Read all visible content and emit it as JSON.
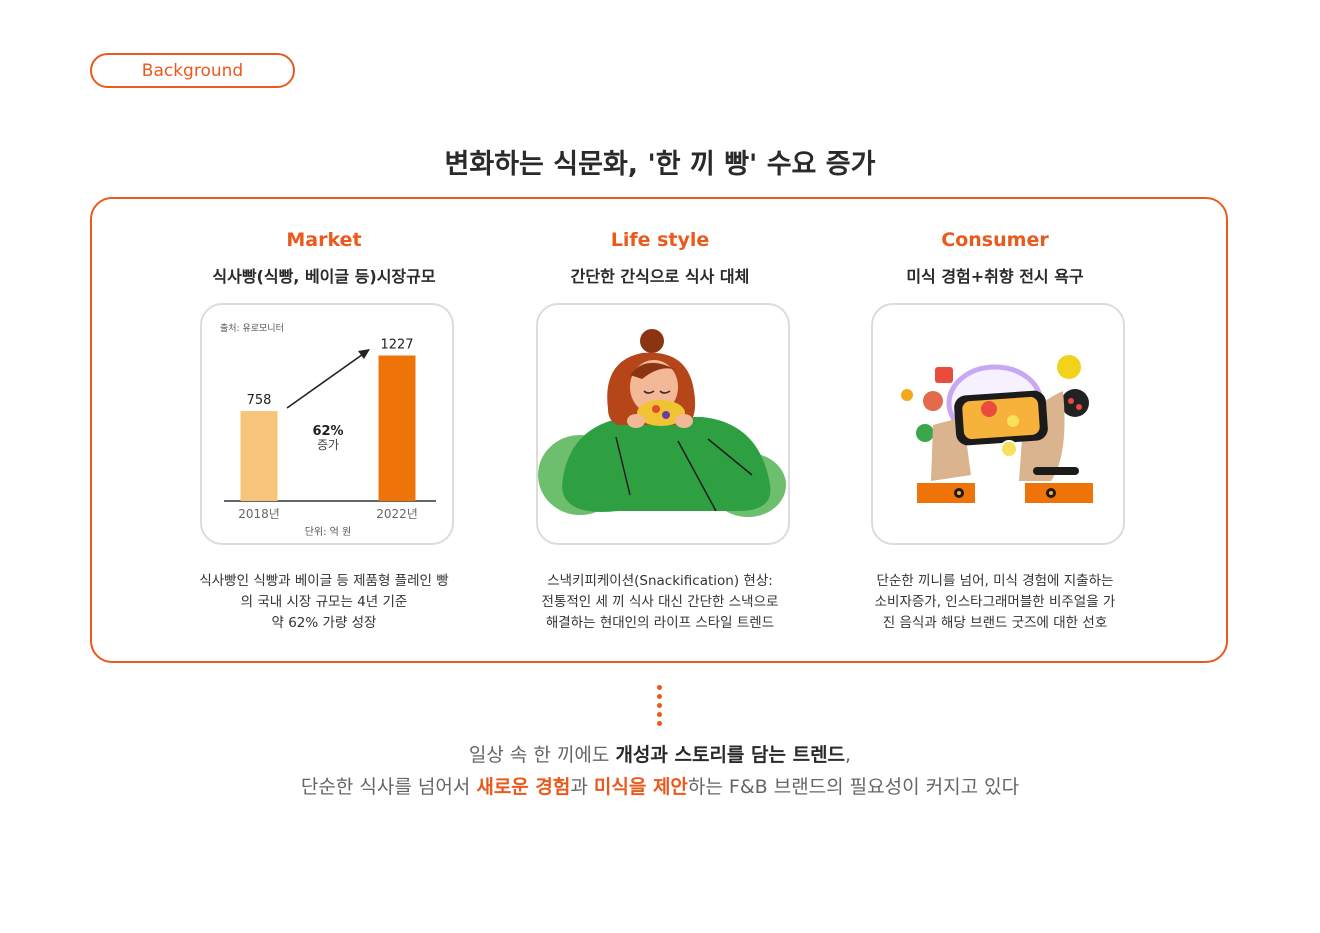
{
  "section_label": "Background",
  "main_title": "변화하는 식문화, '한 끼 빵' 수요 증가",
  "columns": [
    {
      "heading": "Market",
      "subtitle": "식사빵(식빵, 베이글 등)시장규모",
      "desc": [
        "식사빵인 식빵과 베이글 등 제품형 플레인 빵",
        "의 국내 시장 규모는 4년 기준",
        "약 62% 가량 성장"
      ]
    },
    {
      "heading": "Life style",
      "subtitle": "간단한 간식으로 식사 대체",
      "desc": [
        "스낵키피케이션(Snackification) 현상:",
        "전통적인 세 끼 식사 대신 간단한 스낵으로",
        "해결하는 현대인의 라이프 스타일 트렌드"
      ]
    },
    {
      "heading": "Consumer",
      "subtitle": "미식 경험+취향 전시 욕구",
      "desc": [
        "단순한 끼니를 넘어, 미식 경험에 지출하는",
        "소비자증가, 인스타그래머블한 비주얼을 가",
        "진 음식과 해당 브랜드 굿즈에 대한 선호"
      ]
    }
  ],
  "chart_data": {
    "type": "bar",
    "categories": [
      "2018년",
      "2022년"
    ],
    "values": [
      758,
      1227
    ],
    "colors": [
      "#f6c57a",
      "#ee7309"
    ],
    "source": "출처: 유로모니터",
    "unit": "단위: 억 원",
    "growth_value": "62%",
    "growth_label": "증가",
    "ylim": [
      0,
      1400
    ]
  },
  "bottom": {
    "line1_a": "일상 속 한 끼에도 ",
    "line1_b": "개성과 스토리를 담는 트렌드",
    "line1_c": ",",
    "line2_a": "단순한 식사를 넘어서 ",
    "line2_b": "새로운 경험",
    "line2_c": "과 ",
    "line2_d": "미식을 제안",
    "line2_e": "하는 F&B 브랜드의 필요성이 커지고 있다"
  },
  "colors": {
    "accent": "#ea5a1c",
    "bar_2018": "#f6c57a",
    "bar_2022": "#ee7309",
    "green": "#3aa84a"
  },
  "icons": [
    "woman-eating-illustration",
    "phone-food-photo-illustration"
  ]
}
